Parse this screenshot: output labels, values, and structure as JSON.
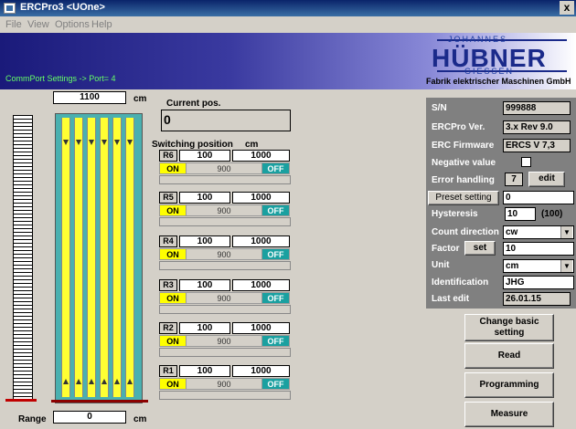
{
  "window": {
    "title": "ERCPro3 <UOne>",
    "close": "x"
  },
  "menu": [
    "File",
    "View",
    "Options",
    "Help"
  ],
  "banner": {
    "comm_status": "CommPort Settings -> Port= 4",
    "logo_top": "JOHANNES",
    "logo_main": "HÜBNER",
    "logo_sub": "GIESSEN",
    "logo_caption": "Fabrik elektrischer Maschinen GmbH"
  },
  "scale": {
    "top_value": "1100",
    "top_unit": "cm",
    "range_label": "Range",
    "range_value": "0",
    "range_unit": "cm"
  },
  "current_pos": {
    "label": "Current pos.",
    "value": "0"
  },
  "switching": {
    "label": "Switching position",
    "unit": "cm",
    "rows": [
      {
        "id": "R6",
        "v1": "100",
        "v2": "1000",
        "on": "ON",
        "mid": "900",
        "off": "OFF"
      },
      {
        "id": "R5",
        "v1": "100",
        "v2": "1000",
        "on": "ON",
        "mid": "900",
        "off": "OFF"
      },
      {
        "id": "R4",
        "v1": "100",
        "v2": "1000",
        "on": "ON",
        "mid": "900",
        "off": "OFF"
      },
      {
        "id": "R3",
        "v1": "100",
        "v2": "1000",
        "on": "ON",
        "mid": "900",
        "off": "OFF"
      },
      {
        "id": "R2",
        "v1": "100",
        "v2": "1000",
        "on": "ON",
        "mid": "900",
        "off": "OFF"
      },
      {
        "id": "R1",
        "v1": "100",
        "v2": "1000",
        "on": "ON",
        "mid": "900",
        "off": "OFF"
      }
    ]
  },
  "panel": {
    "sn_label": "S/N",
    "sn_value": "999888",
    "ver_label": "ERCPro Ver.",
    "ver_value": "3.x Rev 9.0",
    "fw_label": "ERC Firmware",
    "fw_value": "ERCS V 7,3",
    "neg_label": "Negative value",
    "err_label": "Error handling",
    "err_value": "7",
    "err_button": "edit",
    "preset_button": "Preset setting",
    "preset_value": "0",
    "hyst_label": "Hysteresis",
    "hyst_value": "10",
    "hyst_hint": "(100)",
    "count_label": "Count direction",
    "count_value": "cw",
    "factor_label": "Factor",
    "factor_button": "set",
    "factor_value": "10",
    "unit_label": "Unit",
    "unit_value": "cm",
    "ident_label": "Identification",
    "ident_value": "JHG",
    "edit_label": "Last edit",
    "edit_value": "26.01.15"
  },
  "buttons": {
    "change": "Change basic setting",
    "read": "Read",
    "programming": "Programming",
    "measure": "Measure"
  }
}
